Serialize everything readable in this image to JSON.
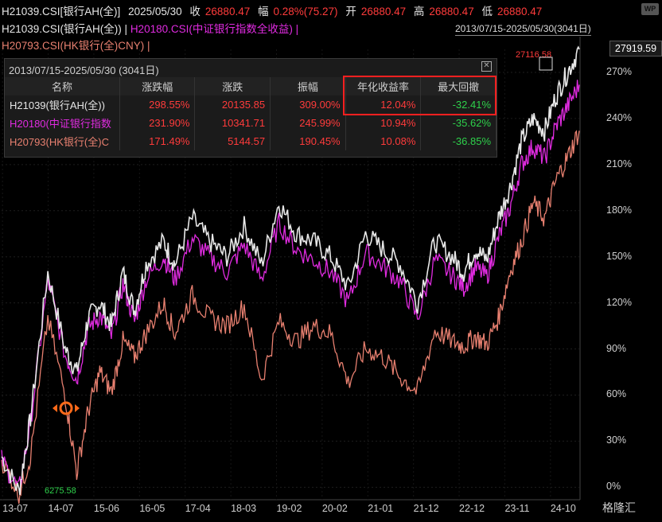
{
  "header": {
    "code": "H21039.CSI[银行AH(全)]",
    "date": "2025/05/30",
    "close_label": "收",
    "close_value": "26880.47",
    "change_label": "幅",
    "change_value": "0.28%(75.27)",
    "open_label": "开",
    "open_value": "26880.47",
    "high_label": "高",
    "high_value": "26880.47",
    "low_label": "低",
    "low_value": "26880.47",
    "line2_a": "H21039.CSI(银行AH(全)) |",
    "line2_b": "H20180.CSI(中证银行指数全收益) |",
    "line3": "H20793.CSI(HK银行(全)CNY) |",
    "range": "2013/07/15-2025/05/30(3041日)",
    "wp_logo": "WP"
  },
  "price_tags": {
    "high_marker": "27116.58",
    "low_marker": "6275.58",
    "last_value": "27919.59"
  },
  "stats_panel": {
    "title": "2013/07/15-2025/05/30 (3041日)",
    "close_icon": "close-icon",
    "headers": [
      "名称",
      "涨跌幅",
      "涨跌",
      "振幅",
      "年化收益率",
      "最大回撤"
    ],
    "rows": [
      {
        "name": "H21039(银行AH(全))",
        "pct": "298.55%",
        "chg": "20135.85",
        "amp": "309.00%",
        "annual": "12.04%",
        "mdd": "-32.41%"
      },
      {
        "name": "H20180(中证银行指数",
        "pct": "231.90%",
        "chg": "10341.71",
        "amp": "245.99%",
        "annual": "10.94%",
        "mdd": "-35.62%"
      },
      {
        "name": "H20793(HK银行(全)C",
        "pct": "171.49%",
        "chg": "5144.57",
        "amp": "190.45%",
        "annual": "10.08%",
        "mdd": "-36.85%"
      }
    ]
  },
  "colors": {
    "series1": "#e8e8e8",
    "series2": "#e02be0",
    "series3": "#e88070",
    "positive": "#ff3b3b",
    "negative": "#2ed14b",
    "highlight_box": "#ff2020"
  },
  "chart_data": {
    "type": "line",
    "y_unit": "%",
    "ylim": [
      -5,
      285
    ],
    "y_ticks": [
      "270%",
      "240%",
      "210%",
      "180%",
      "150%",
      "120%",
      "90%",
      "60%",
      "30%",
      "0%"
    ],
    "x_ticks": [
      "13-07",
      "14-07",
      "15-06",
      "16-05",
      "17-04",
      "18-03",
      "19-02",
      "20-02",
      "21-01",
      "21-12",
      "22-12",
      "23-11",
      "24-10"
    ],
    "x": [
      0,
      0.03,
      0.05,
      0.08,
      0.11,
      0.13,
      0.15,
      0.17,
      0.19,
      0.21,
      0.23,
      0.25,
      0.28,
      0.3,
      0.33,
      0.36,
      0.39,
      0.42,
      0.45,
      0.48,
      0.51,
      0.54,
      0.57,
      0.6,
      0.63,
      0.66,
      0.69,
      0.72,
      0.75,
      0.78,
      0.8,
      0.82,
      0.84,
      0.86,
      0.88,
      0.9,
      0.92,
      0.94,
      0.96,
      0.98,
      1.0
    ],
    "series": [
      {
        "name": "H21039(银行AH(全))",
        "values": [
          20,
          -3,
          45,
          140,
          90,
          75,
          110,
          120,
          105,
          140,
          115,
          145,
          160,
          145,
          175,
          160,
          150,
          170,
          145,
          185,
          165,
          160,
          150,
          130,
          165,
          155,
          145,
          120,
          160,
          150,
          140,
          155,
          148,
          175,
          195,
          225,
          240,
          232,
          255,
          270,
          285
        ]
      },
      {
        "name": "H20180(中证银行指数",
        "values": [
          18,
          -2,
          42,
          135,
          86,
          70,
          104,
          112,
          98,
          132,
          108,
          135,
          150,
          135,
          162,
          150,
          140,
          158,
          135,
          172,
          155,
          148,
          140,
          120,
          153,
          144,
          134,
          110,
          148,
          138,
          130,
          143,
          137,
          162,
          182,
          210,
          222,
          214,
          235,
          248,
          262
        ]
      },
      {
        "name": "H20793(HK银行(全)C",
        "values": [
          18,
          -4,
          20,
          110,
          60,
          10,
          50,
          75,
          62,
          95,
          85,
          100,
          120,
          100,
          125,
          110,
          105,
          118,
          70,
          108,
          95,
          105,
          100,
          68,
          90,
          85,
          72,
          62,
          102,
          95,
          92,
          98,
          93,
          110,
          140,
          160,
          185,
          175,
          200,
          215,
          232
        ]
      }
    ]
  },
  "footer": {
    "logo": "格隆汇"
  }
}
